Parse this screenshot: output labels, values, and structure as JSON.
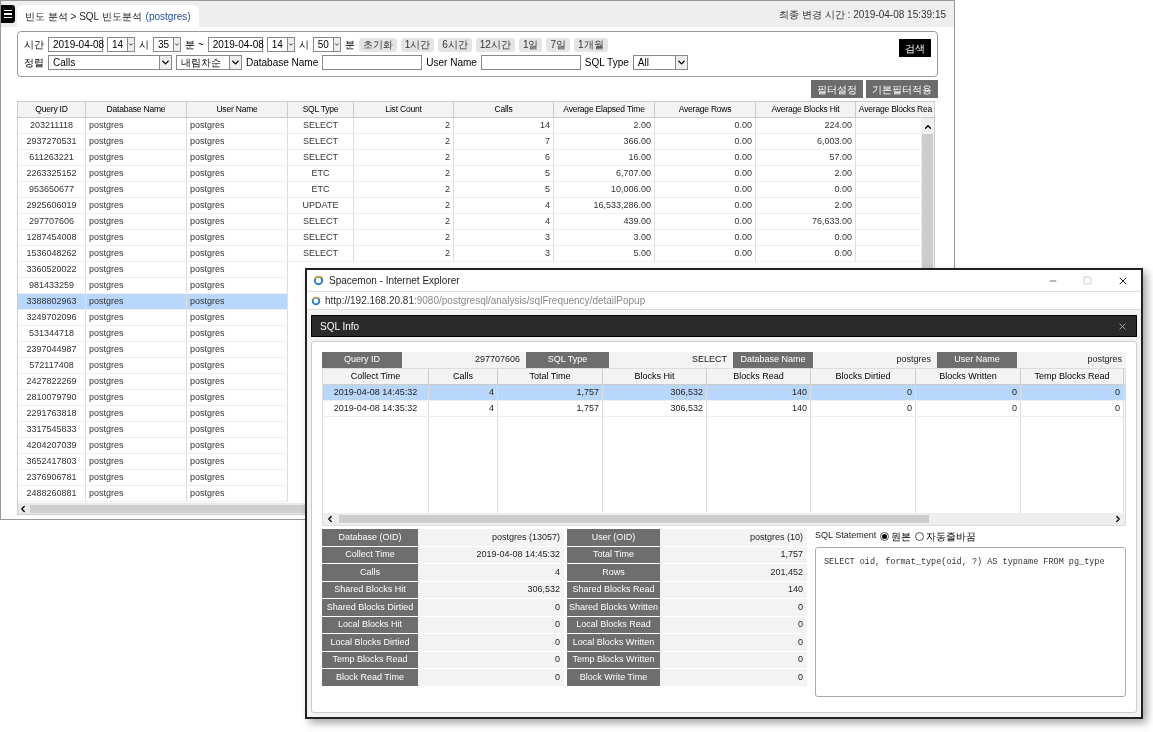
{
  "main_window": {
    "breadcrumb": "빈도 분석 > SQL 빈도분석",
    "breadcrumb_db": "(postgres)",
    "last_modified": "최종 변경 시간 : 2019-04-08 15:39:15",
    "filters": {
      "time_label": "시간",
      "from_date": "2019-04-08",
      "from_hour": "14",
      "hour_unit_1": "시",
      "from_minute": "35",
      "minute_unit_1": "분 ~",
      "to_date": "2019-04-08",
      "to_hour": "14",
      "hour_unit_2": "시",
      "to_minute": "50",
      "minute_unit_2": "분",
      "quick_buttons": [
        "초기화",
        "1시간",
        "6시간",
        "12시간",
        "1일",
        "7일",
        "1개월"
      ],
      "search_button": "검색",
      "sort_label": "정렬",
      "sort_field": "Calls",
      "sort_order": "내림차순",
      "db_name_label": "Database Name",
      "user_name_label": "User Name",
      "sql_type_label": "SQL Type",
      "sql_type": "All"
    },
    "action_buttons": [
      "필터설정",
      "기본필터적용"
    ],
    "table": {
      "columns": [
        "Query ID",
        "Database Name",
        "User Name",
        "SQL Type",
        "List Count",
        "Calls",
        "Average Elapsed Time",
        "Average Rows",
        "Average Blocks Hit",
        "Average Blocks Rea"
      ],
      "rows": [
        {
          "selected": false,
          "cells": [
            "203211118",
            "postgres",
            "postgres",
            "SELECT",
            "2",
            "14",
            "2.00",
            "0.00",
            "224.00"
          ]
        },
        {
          "selected": false,
          "cells": [
            "2937270531",
            "postgres",
            "postgres",
            "SELECT",
            "2",
            "7",
            "366.00",
            "0.00",
            "6,003.00"
          ]
        },
        {
          "selected": false,
          "cells": [
            "611263221",
            "postgres",
            "postgres",
            "SELECT",
            "2",
            "6",
            "16.00",
            "0.00",
            "57.00"
          ]
        },
        {
          "selected": false,
          "cells": [
            "2263325152",
            "postgres",
            "postgres",
            "ETC",
            "2",
            "5",
            "6,707.00",
            "0.00",
            "2.00"
          ]
        },
        {
          "selected": false,
          "cells": [
            "953650677",
            "postgres",
            "postgres",
            "ETC",
            "2",
            "5",
            "10,006.00",
            "0.00",
            "0.00"
          ]
        },
        {
          "selected": false,
          "cells": [
            "2925606019",
            "postgres",
            "postgres",
            "UPDATE",
            "2",
            "4",
            "16,533,286.00",
            "0.00",
            "2.00"
          ]
        },
        {
          "selected": false,
          "cells": [
            "297707606",
            "postgres",
            "postgres",
            "SELECT",
            "2",
            "4",
            "439.00",
            "0.00",
            "76,633.00"
          ]
        },
        {
          "selected": false,
          "cells": [
            "1287454008",
            "postgres",
            "postgres",
            "SELECT",
            "2",
            "3",
            "3.00",
            "0.00",
            "0.00"
          ]
        },
        {
          "selected": false,
          "cells": [
            "1536048262",
            "postgres",
            "postgres",
            "SELECT",
            "2",
            "3",
            "5.00",
            "0.00",
            "0.00"
          ]
        },
        {
          "selected": false,
          "cells": [
            "3360520022",
            "postgres",
            "postgres"
          ]
        },
        {
          "selected": false,
          "cells": [
            "981433259",
            "postgres",
            "postgres"
          ]
        },
        {
          "selected": true,
          "cells": [
            "3388802963",
            "postgres",
            "postgres"
          ]
        },
        {
          "selected": false,
          "cells": [
            "3249702096",
            "postgres",
            "postgres"
          ]
        },
        {
          "selected": false,
          "cells": [
            "531344718",
            "postgres",
            "postgres"
          ]
        },
        {
          "selected": false,
          "cells": [
            "2397044987",
            "postgres",
            "postgres"
          ]
        },
        {
          "selected": false,
          "cells": [
            "572117408",
            "postgres",
            "postgres"
          ]
        },
        {
          "selected": false,
          "cells": [
            "2427822269",
            "postgres",
            "postgres"
          ]
        },
        {
          "selected": false,
          "cells": [
            "2810079790",
            "postgres",
            "postgres"
          ]
        },
        {
          "selected": false,
          "cells": [
            "2291763818",
            "postgres",
            "postgres"
          ]
        },
        {
          "selected": false,
          "cells": [
            "3317545833",
            "postgres",
            "postgres"
          ]
        },
        {
          "selected": false,
          "cells": [
            "4204207039",
            "postgres",
            "postgres"
          ]
        },
        {
          "selected": false,
          "cells": [
            "3652417803",
            "postgres",
            "postgres"
          ]
        },
        {
          "selected": false,
          "cells": [
            "2376906781",
            "postgres",
            "postgres"
          ]
        },
        {
          "selected": false,
          "cells": [
            "2488260881",
            "postgres",
            "postgres"
          ]
        }
      ]
    }
  },
  "popup": {
    "title": "Spacemon - Internet Explorer",
    "url_host": "http://192.168.20.81",
    "url_path": ":9080/postgresql/analysis/sqlFrequency/detailPopup",
    "panel_title": "SQL Info",
    "summary": [
      {
        "label": "Query ID",
        "value": "297707606"
      },
      {
        "label": "SQL Type",
        "value": "SELECT"
      },
      {
        "label": "Database Name",
        "value": "postgres"
      },
      {
        "label": "User Name",
        "value": "postgres"
      }
    ],
    "grid": {
      "columns": [
        "Collect Time",
        "Calls",
        "Total Time",
        "Blocks Hit",
        "Blocks Read",
        "Blocks Dirtied",
        "Blocks Written",
        "Temp Blocks Read"
      ],
      "rows": [
        {
          "selected": true,
          "cells": [
            "2019-04-08 14:45:32",
            "4",
            "1,757",
            "306,532",
            "140",
            "0",
            "0",
            "0"
          ]
        },
        {
          "selected": false,
          "cells": [
            "2019-04-08 14:35:32",
            "4",
            "1,757",
            "306,532",
            "140",
            "0",
            "0",
            "0"
          ]
        }
      ]
    },
    "details": [
      {
        "label": "Database (OID)",
        "value": "postgres (13057)"
      },
      {
        "label": "User (OID)",
        "value": "postgres (10)"
      },
      {
        "label": "Collect Time",
        "value": "2019-04-08 14:45:32"
      },
      {
        "label": "Total Time",
        "value": "1,757"
      },
      {
        "label": "Calls",
        "value": "4"
      },
      {
        "label": "Rows",
        "value": "201,452"
      },
      {
        "label": "Shared Blocks Hit",
        "value": "306,532"
      },
      {
        "label": "Shared Blocks Read",
        "value": "140"
      },
      {
        "label": "Shared Blocks Dirtied",
        "value": "0"
      },
      {
        "label": "Shared Blocks Written",
        "value": "0"
      },
      {
        "label": "Local Blocks Hit",
        "value": "0"
      },
      {
        "label": "Local Blocks Read",
        "value": "0"
      },
      {
        "label": "Local Blocks Dirtied",
        "value": "0"
      },
      {
        "label": "Local Blocks Written",
        "value": "0"
      },
      {
        "label": "Temp Blocks Read",
        "value": "0"
      },
      {
        "label": "Temp Blocks Written",
        "value": "0"
      },
      {
        "label": "Block Read Time",
        "value": "0"
      },
      {
        "label": "Block Write Time",
        "value": "0"
      }
    ],
    "sql_statement": {
      "label": "SQL Statement",
      "options": [
        {
          "label": "원본",
          "selected": true
        },
        {
          "label": "자동줄바꿈",
          "selected": false
        }
      ],
      "text": "SELECT oid, format_type(oid, ?) AS typname FROM pg_type"
    }
  }
}
